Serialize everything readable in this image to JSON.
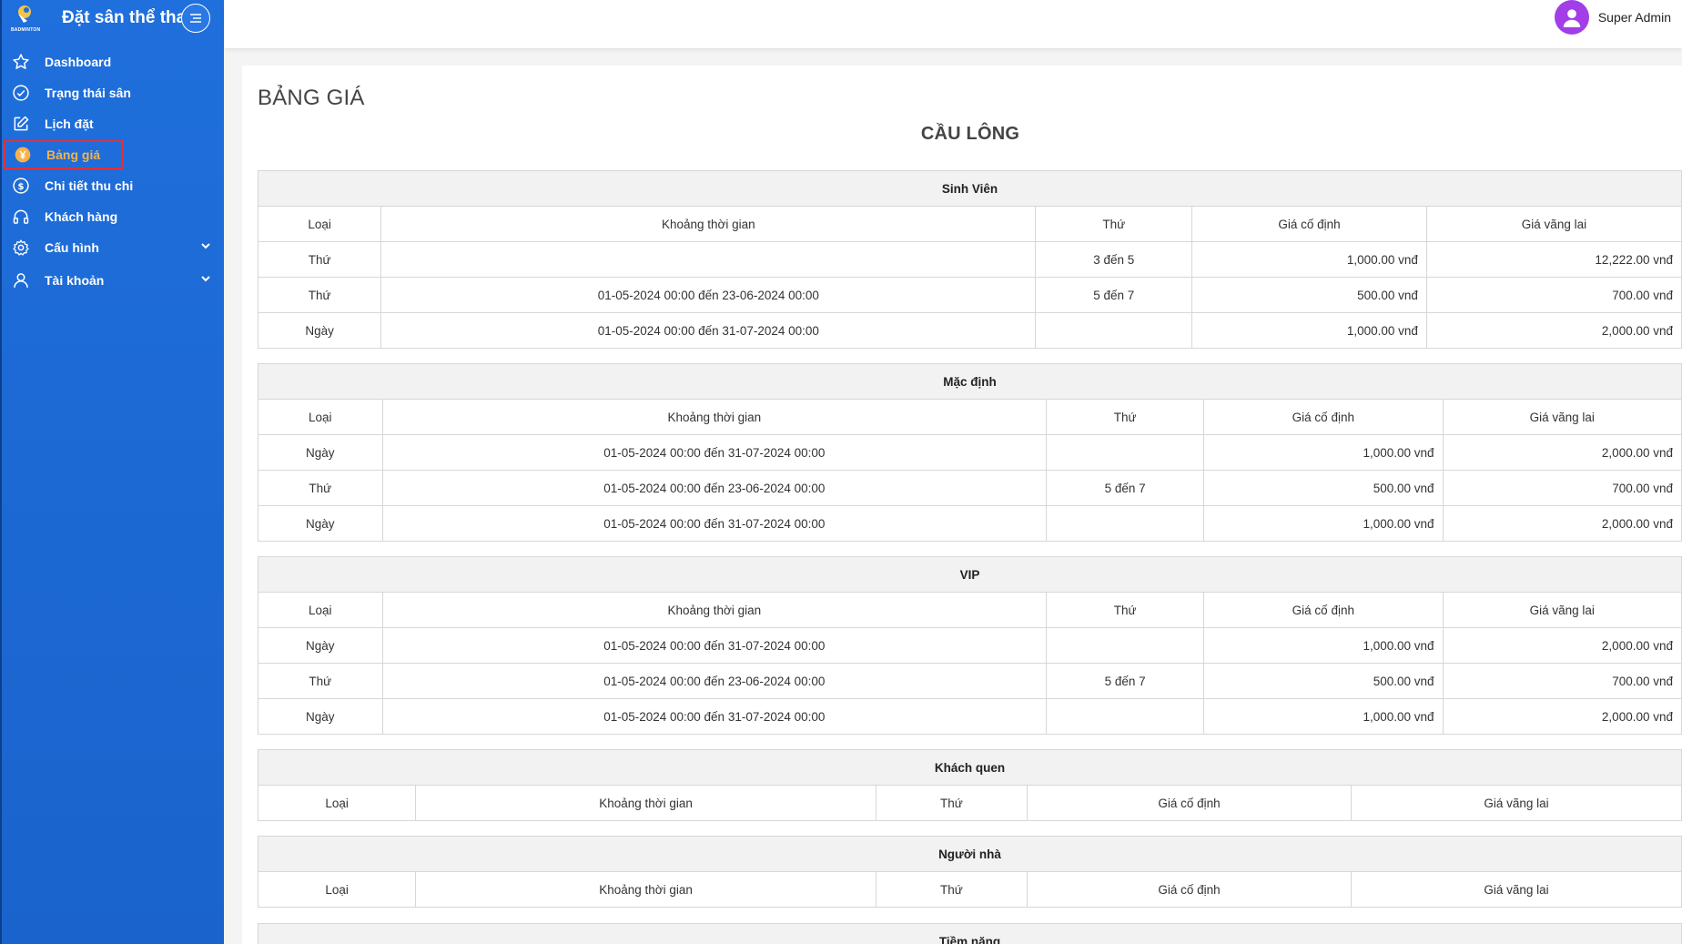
{
  "brand": {
    "title": "Đặt sân thể thao",
    "logo_text": "BADMINTON",
    "menu_icon": "menu-lines-icon"
  },
  "nav": [
    {
      "label": "Dashboard",
      "icon": "star-icon"
    },
    {
      "label": "Trạng thái sân",
      "icon": "check-circle-icon"
    },
    {
      "label": "Lịch đặt",
      "icon": "edit-icon"
    },
    {
      "label": "Bảng giá",
      "icon": "yen-coin-icon",
      "active": true
    },
    {
      "label": "Chi tiết thu chi",
      "icon": "dollar-circle-icon"
    },
    {
      "label": "Khách hàng",
      "icon": "headphones-icon"
    },
    {
      "label": "Cấu hình",
      "icon": "gear-icon",
      "expandable": true
    },
    {
      "label": "Tài khoản",
      "icon": "user-icon",
      "expandable": true
    }
  ],
  "user": {
    "name": "Super Admin",
    "avatar_color": "#a23ee8"
  },
  "page": {
    "title": "BẢNG GIÁ",
    "sport": "CẦU LÔNG"
  },
  "columns": [
    "Loại",
    "Khoảng thời gian",
    "Thứ",
    "Giá cố định",
    "Giá vãng lai"
  ],
  "groups": [
    {
      "name": "Sinh Viên",
      "rows": [
        [
          "Thứ",
          "",
          "3 đến 5",
          "1,000.00 vnđ",
          "12,222.00 vnđ"
        ],
        [
          "Thứ",
          "01-05-2024 00:00 đến 23-06-2024 00:00",
          "5 đến 7",
          "500.00 vnđ",
          "700.00 vnđ"
        ],
        [
          "Ngày",
          "01-05-2024 00:00 đến 31-07-2024 00:00",
          "",
          "1,000.00 vnđ",
          "2,000.00 vnđ"
        ]
      ]
    },
    {
      "name": "Mặc định",
      "rows": [
        [
          "Ngày",
          "01-05-2024 00:00 đến 31-07-2024 00:00",
          "",
          "1,000.00 vnđ",
          "2,000.00 vnđ"
        ],
        [
          "Thứ",
          "01-05-2024 00:00 đến 23-06-2024 00:00",
          "5 đến 7",
          "500.00 vnđ",
          "700.00 vnđ"
        ],
        [
          "Ngày",
          "01-05-2024 00:00 đến 31-07-2024 00:00",
          "",
          "1,000.00 vnđ",
          "2,000.00 vnđ"
        ]
      ]
    },
    {
      "name": "VIP",
      "rows": [
        [
          "Ngày",
          "01-05-2024 00:00 đến 31-07-2024 00:00",
          "",
          "1,000.00 vnđ",
          "2,000.00 vnđ"
        ],
        [
          "Thứ",
          "01-05-2024 00:00 đến 23-06-2024 00:00",
          "5 đến 7",
          "500.00 vnđ",
          "700.00 vnđ"
        ],
        [
          "Ngày",
          "01-05-2024 00:00 đến 31-07-2024 00:00",
          "",
          "1,000.00 vnđ",
          "2,000.00 vnđ"
        ]
      ]
    },
    {
      "name": "Khách quen",
      "rows": []
    },
    {
      "name": "Người nhà",
      "rows": []
    },
    {
      "name": "Tiềm năng",
      "rows": []
    }
  ]
}
